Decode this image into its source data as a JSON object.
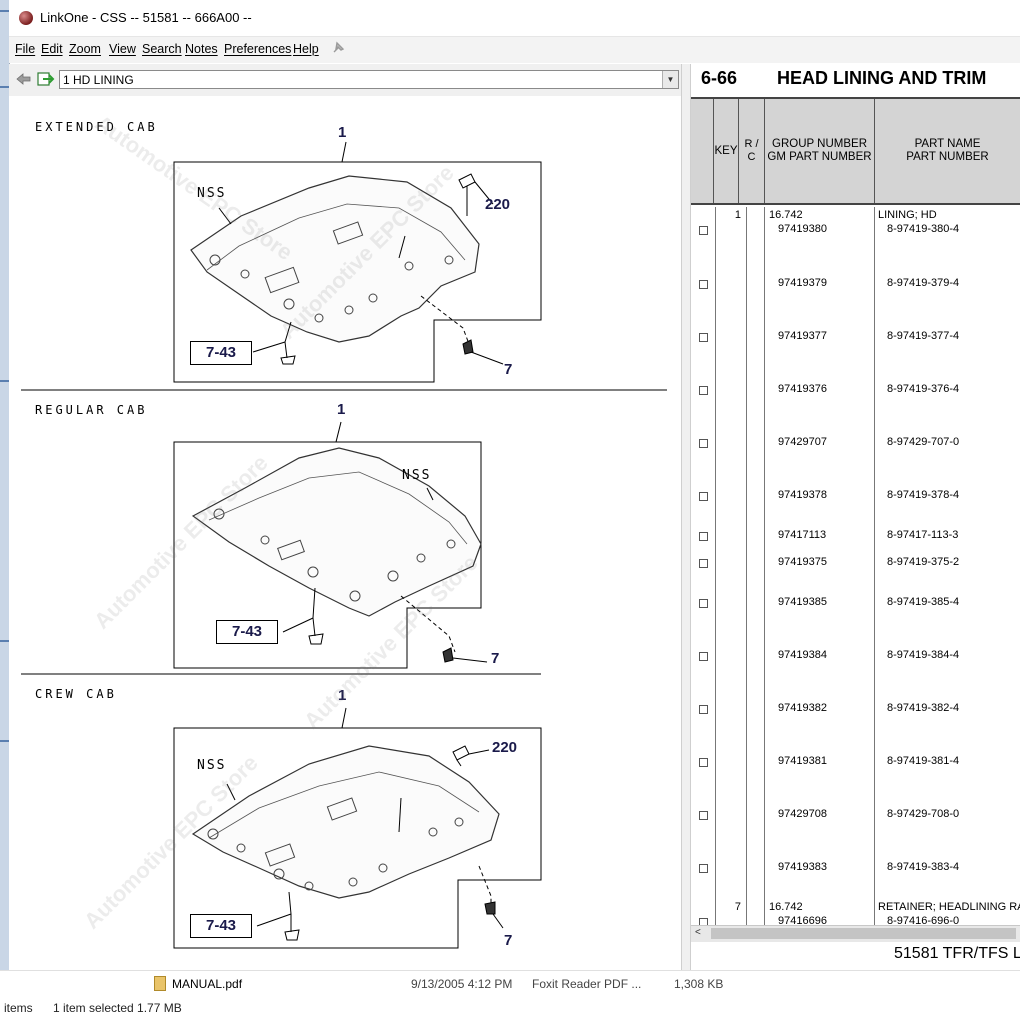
{
  "window": {
    "title": "LinkOne - CSS -- 51581 -- 666A00 --"
  },
  "menu": [
    "File",
    "Edit",
    "Zoom",
    "View",
    "Search",
    "Notes",
    "Preferences",
    "Help"
  ],
  "toolbar": {
    "combo_value": "1 HD LINING"
  },
  "drawing": {
    "sections": [
      {
        "label": "EXTENDED CAB",
        "callouts": {
          "part": "1",
          "nss": "NSS",
          "clip": "220",
          "ref": "7-43",
          "screw": "7"
        }
      },
      {
        "label": "REGULAR CAB",
        "callouts": {
          "part": "1",
          "nss": "NSS",
          "ref": "7-43",
          "screw": "7"
        }
      },
      {
        "label": "CREW CAB",
        "callouts": {
          "part": "1",
          "nss": "NSS",
          "clip": "220",
          "ref": "7-43",
          "screw": "7"
        }
      }
    ],
    "watermark": "Automotive EPC Store"
  },
  "parts_page": {
    "page_number": "6-66",
    "title": "HEAD LINING AND TRIM",
    "headers": {
      "key": "KEY",
      "rc": "R / C",
      "group": [
        "GROUP NUMBER",
        "GM PART NUMBER"
      ],
      "part": [
        "PART NAME",
        "PART NUMBER"
      ]
    },
    "rows": [
      {
        "key": "1",
        "group": "16.742",
        "gm": "97419380",
        "name": "LINING; HD",
        "part": "8-97419-380-4"
      },
      {
        "gm": "97419379",
        "part": "8-97419-379-4"
      },
      {
        "gm": "97419377",
        "part": "8-97419-377-4"
      },
      {
        "gm": "97419376",
        "part": "8-97419-376-4"
      },
      {
        "gm": "97429707",
        "part": "8-97429-707-0"
      },
      {
        "gm": "97419378",
        "part": "8-97419-378-4"
      },
      {
        "gm": "97417113",
        "part": "8-97417-113-3"
      },
      {
        "gm": "97419375",
        "part": "8-97419-375-2"
      },
      {
        "gm": "97419385",
        "part": "8-97419-385-4"
      },
      {
        "gm": "97419384",
        "part": "8-97419-384-4"
      },
      {
        "gm": "97419382",
        "part": "8-97419-382-4"
      },
      {
        "gm": "97419381",
        "part": "8-97419-381-4"
      },
      {
        "gm": "97429708",
        "part": "8-97429-708-0"
      },
      {
        "gm": "97419383",
        "part": "8-97419-383-4"
      },
      {
        "key": "7",
        "group": "16.742",
        "gm": "97416696",
        "name": "RETAINER; HEADLINING RA",
        "part": "8-97416-696-0"
      }
    ],
    "footer": "51581 TFR/TFS L"
  },
  "explorer": {
    "file_name": "MANUAL.pdf",
    "file_date": "9/13/2005 4:12 PM",
    "file_type": "Foxit Reader PDF ...",
    "file_size": "1,308 KB",
    "status_items": "items",
    "status_selected": "1 item selected  1.77 MB"
  }
}
